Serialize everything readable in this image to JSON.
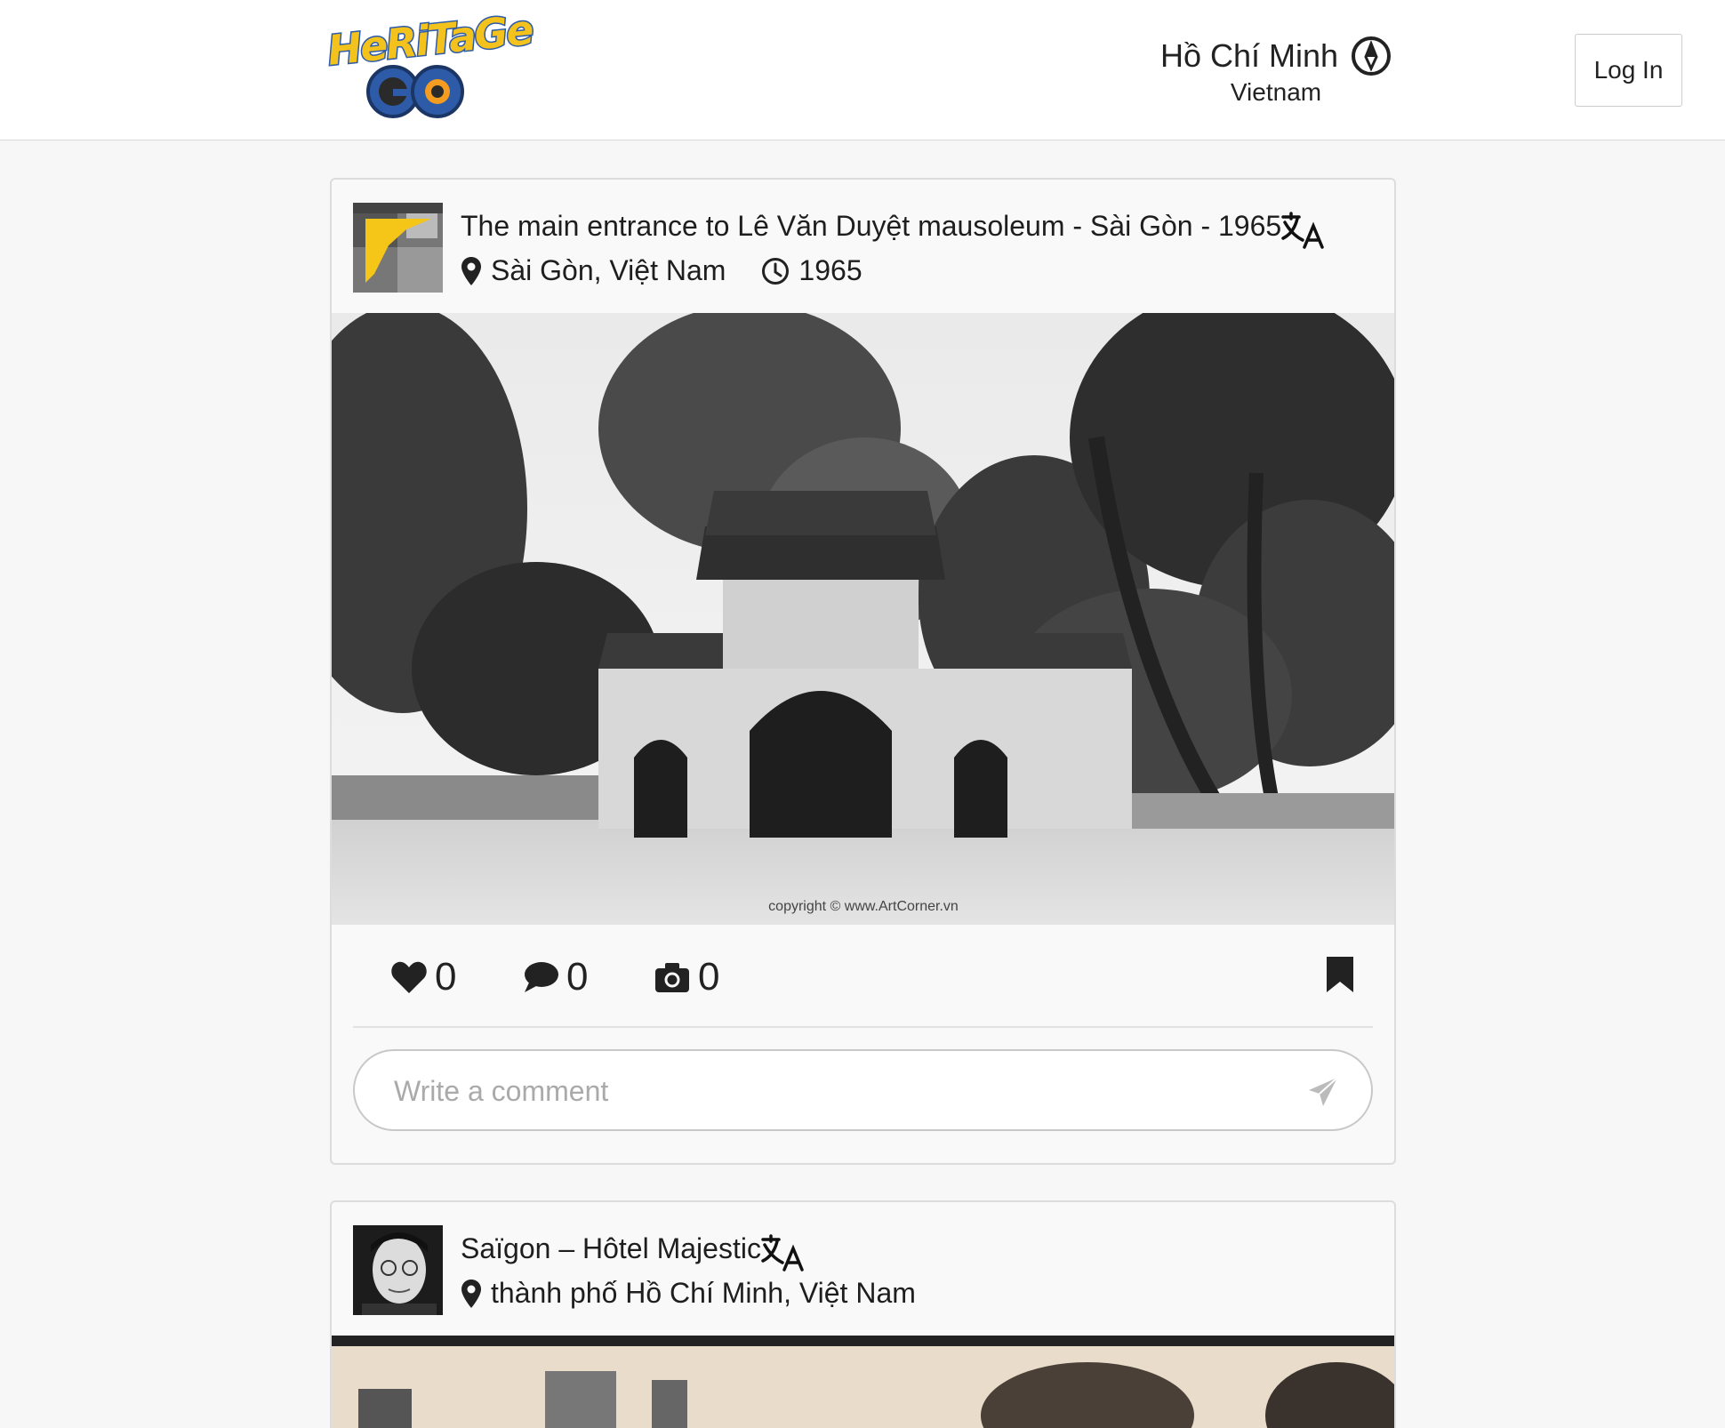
{
  "header": {
    "logo_text": "HeRiTaGe GO",
    "location_city": "Hồ Chí Minh",
    "location_country": "Vietnam",
    "login_label": "Log In"
  },
  "posts": [
    {
      "title": "The main entrance to Lê Văn Duyệt mausoleum - Sài Gòn - 1965",
      "place": "Sài Gòn, Việt Nam",
      "year": "1965",
      "likes": "0",
      "comments": "0",
      "photos": "0",
      "photo_caption": "copyright © www.ArtCorner.vn",
      "comment_placeholder": "Write a comment"
    },
    {
      "title": "Saïgon – Hôtel Majestic",
      "place": "thành phố Hồ Chí Minh, Việt Nam"
    }
  ],
  "icons": {
    "compass": "compass-icon",
    "translate": "translate-icon",
    "pin": "map-pin-icon",
    "clock": "clock-icon",
    "heart": "heart-icon",
    "comment": "comment-icon",
    "camera": "camera-icon",
    "bookmark": "bookmark-icon",
    "send": "send-icon"
  },
  "colors": {
    "logo_yellow": "#f3c21c",
    "logo_blue": "#2d5ba8",
    "border": "#dcdcdc"
  }
}
